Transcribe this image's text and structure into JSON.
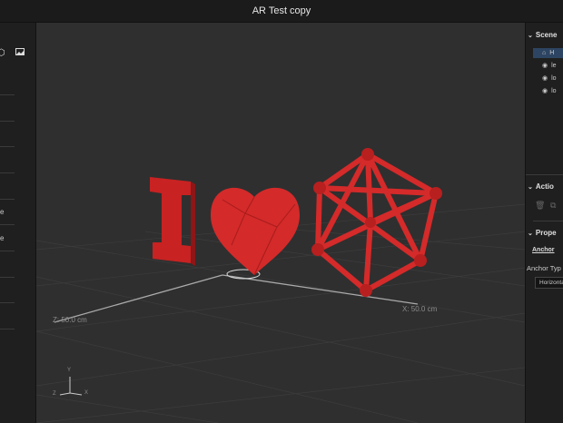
{
  "window": {
    "title": "AR Test copy"
  },
  "left_panel": {
    "fragments": [
      "e",
      "e"
    ]
  },
  "viewport": {
    "z_label": "Z: 50.0 cm",
    "x_label": "X: 50.0 cm",
    "gizmo": {
      "y": "Y",
      "z": "Z",
      "x": "X"
    }
  },
  "right_panel": {
    "scene": {
      "title": "Scene",
      "items": [
        {
          "label": "H",
          "icon": "anchor-icon",
          "selected": true
        },
        {
          "label": "le",
          "icon": "object-icon"
        },
        {
          "label": "lo",
          "icon": "object-icon"
        },
        {
          "label": "lo",
          "icon": "object-icon"
        }
      ]
    },
    "actions": {
      "title": "Actio"
    },
    "properties": {
      "title": "Prope",
      "tab": "Anchor",
      "anchor_type_label": "Anchor Typ",
      "anchor_type_value": "Horizonta"
    }
  },
  "colors": {
    "accent": "#2d4562",
    "object_red": "#d42a2a"
  }
}
